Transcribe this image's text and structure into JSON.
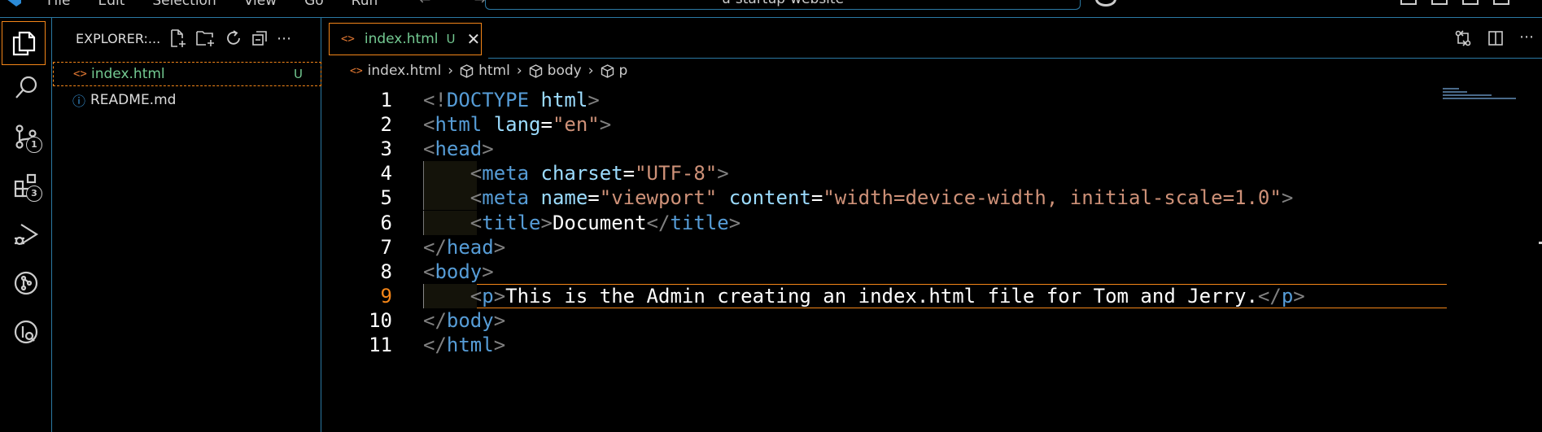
{
  "titlebar": {
    "menu": [
      "File",
      "Edit",
      "Selection",
      "View",
      "Go",
      "Run"
    ],
    "nav": "← →",
    "search_text": "u-startup-website"
  },
  "activity_bar": {
    "items": [
      {
        "name": "explorer",
        "icon": "files-icon",
        "active": true
      },
      {
        "name": "search",
        "icon": "search-icon"
      },
      {
        "name": "source-control",
        "icon": "source-control-icon",
        "badge": "1"
      },
      {
        "name": "extensions",
        "icon": "extensions-icon",
        "badge": "3"
      },
      {
        "name": "run-and-debug",
        "icon": "run-debug-icon"
      },
      {
        "name": "git-graph",
        "icon": "git-graph-icon"
      },
      {
        "name": "gitlens",
        "icon": "gitlens-icon"
      }
    ]
  },
  "sidebar": {
    "title": "EXPLORER:...",
    "files": [
      {
        "name": "index.html",
        "icon": "<>",
        "git": "U",
        "selected": true
      },
      {
        "name": "README.md",
        "icon": "ⓘ"
      }
    ]
  },
  "editor": {
    "tab": {
      "label": "index.html",
      "icon": "<>",
      "git": "U",
      "close": "✕"
    },
    "breadcrumb": [
      "index.html",
      "html",
      "body",
      "p"
    ],
    "current_line": 9,
    "lines": [
      {
        "n": "1",
        "tokens": [
          [
            "b",
            "<!"
          ],
          [
            "t",
            "DOCTYPE"
          ],
          [
            "w",
            " "
          ],
          [
            "a",
            "html"
          ],
          [
            "b",
            ">"
          ]
        ]
      },
      {
        "n": "2",
        "tokens": [
          [
            "b",
            "<"
          ],
          [
            "t",
            "html"
          ],
          [
            "w",
            " "
          ],
          [
            "a",
            "lang"
          ],
          [
            "w",
            "="
          ],
          [
            "s",
            "\"en\""
          ],
          [
            "b",
            ">"
          ]
        ]
      },
      {
        "n": "3",
        "tokens": [
          [
            "b",
            "<"
          ],
          [
            "t",
            "head"
          ],
          [
            "b",
            ">"
          ]
        ]
      },
      {
        "n": "4",
        "tokens": [
          [
            "w",
            "    "
          ],
          [
            "b",
            "<"
          ],
          [
            "t",
            "meta"
          ],
          [
            "w",
            " "
          ],
          [
            "a",
            "charset"
          ],
          [
            "w",
            "="
          ],
          [
            "s",
            "\"UTF-8\""
          ],
          [
            "b",
            ">"
          ]
        ]
      },
      {
        "n": "5",
        "tokens": [
          [
            "w",
            "    "
          ],
          [
            "b",
            "<"
          ],
          [
            "t",
            "meta"
          ],
          [
            "w",
            " "
          ],
          [
            "a",
            "name"
          ],
          [
            "w",
            "="
          ],
          [
            "s",
            "\"viewport\""
          ],
          [
            "w",
            " "
          ],
          [
            "a",
            "content"
          ],
          [
            "w",
            "="
          ],
          [
            "s",
            "\"width=device-width, initial-scale=1.0\""
          ],
          [
            "b",
            ">"
          ]
        ]
      },
      {
        "n": "6",
        "tokens": [
          [
            "w",
            "    "
          ],
          [
            "b",
            "<"
          ],
          [
            "t",
            "title"
          ],
          [
            "b",
            ">"
          ],
          [
            "w",
            "Document"
          ],
          [
            "b",
            "</"
          ],
          [
            "t",
            "title"
          ],
          [
            "b",
            ">"
          ]
        ]
      },
      {
        "n": "7",
        "tokens": [
          [
            "b",
            "</"
          ],
          [
            "t",
            "head"
          ],
          [
            "b",
            ">"
          ]
        ]
      },
      {
        "n": "8",
        "tokens": [
          [
            "b",
            "<"
          ],
          [
            "t",
            "body"
          ],
          [
            "b",
            ">"
          ]
        ]
      },
      {
        "n": "9",
        "tokens": [
          [
            "w",
            "    "
          ],
          [
            "b",
            "<"
          ],
          [
            "t",
            "p"
          ],
          [
            "b",
            ">"
          ],
          [
            "w",
            "This is the Admin creating an index.html file for Tom and Jerry."
          ],
          [
            "b",
            "</"
          ],
          [
            "t",
            "p"
          ],
          [
            "b",
            ">"
          ]
        ]
      },
      {
        "n": "10",
        "tokens": [
          [
            "b",
            "</"
          ],
          [
            "t",
            "body"
          ],
          [
            "b",
            ">"
          ]
        ]
      },
      {
        "n": "11",
        "tokens": [
          [
            "b",
            "</"
          ],
          [
            "t",
            "html"
          ],
          [
            "b",
            ">"
          ]
        ]
      }
    ]
  },
  "colors": {
    "focus_border": "#f38518",
    "contrast_border": "#2b79a3",
    "tag": "#569cd6",
    "attribute": "#9cdcfe",
    "string": "#ce9178",
    "bracket": "#808080",
    "untracked": "#73c991"
  }
}
